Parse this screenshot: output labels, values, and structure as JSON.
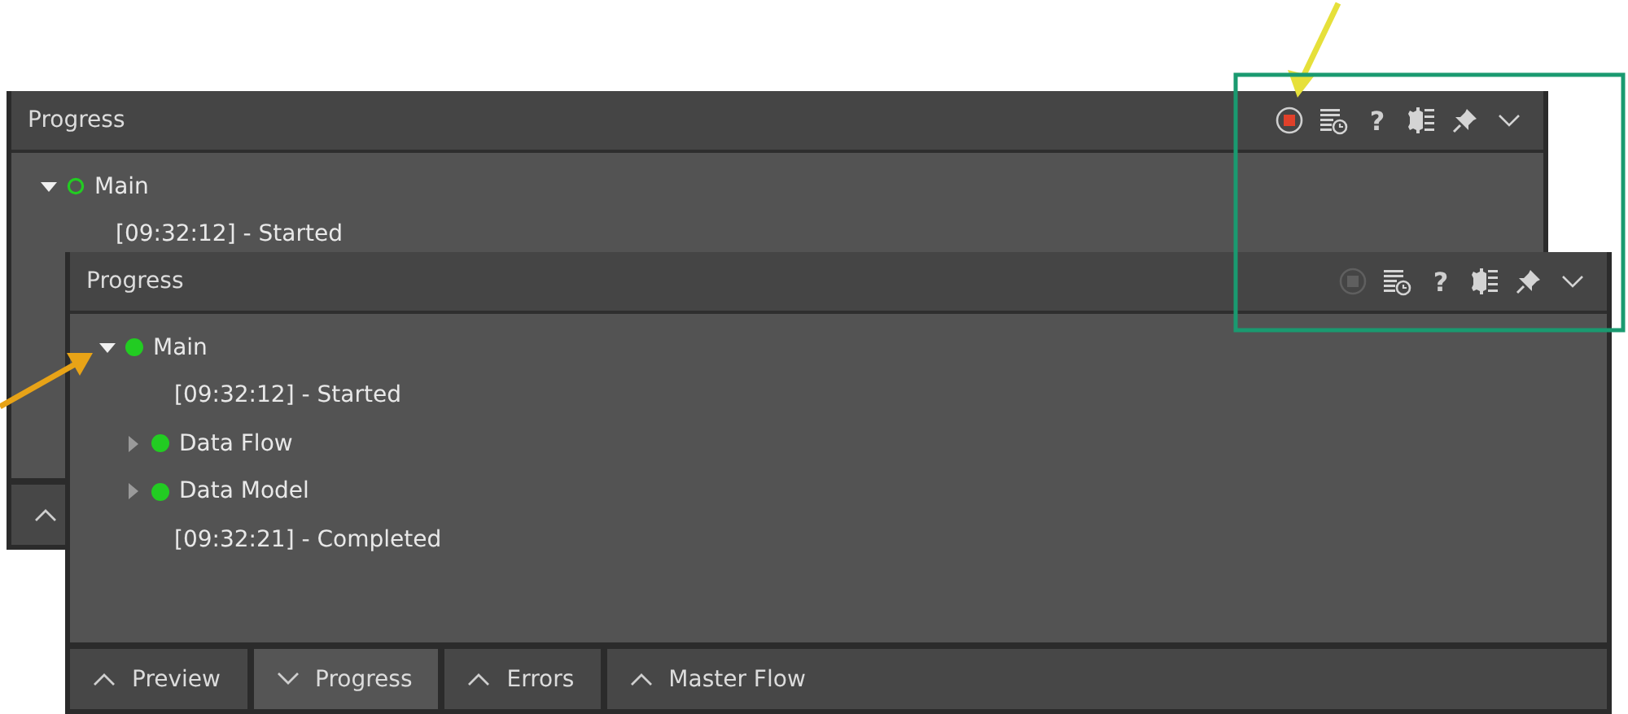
{
  "panels": [
    {
      "title": "Progress",
      "toolbar": {
        "stop_enabled": true,
        "help": "?"
      },
      "tree": [
        {
          "kind": "node",
          "label": "Main",
          "expanded": true,
          "in_progress": true,
          "color": "#22cc22",
          "children": [
            {
              "kind": "log",
              "label": "[09:32:12] - Started"
            }
          ]
        }
      ],
      "tabs": [
        {
          "selected": false
        }
      ]
    },
    {
      "title": "Progress",
      "toolbar": {
        "stop_enabled": false,
        "help": "?"
      },
      "tree": [
        {
          "kind": "node",
          "label": "Main",
          "expanded": true,
          "in_progress": false,
          "color": "#22cc22",
          "children": [
            {
              "kind": "log",
              "label": "[09:32:12] - Started"
            },
            {
              "kind": "node",
              "label": "Data Flow",
              "expanded": false,
              "in_progress": false,
              "color": "#22cc22"
            },
            {
              "kind": "node",
              "label": "Data Model",
              "expanded": false,
              "in_progress": false,
              "color": "#22cc22"
            },
            {
              "kind": "log",
              "label": "[09:32:21] - Completed"
            }
          ]
        }
      ],
      "tabs": [
        {
          "label": "Preview",
          "selected": false
        },
        {
          "label": "Progress",
          "selected": true
        },
        {
          "label": "Errors",
          "selected": false
        },
        {
          "label": "Master Flow",
          "selected": false
        }
      ]
    }
  ],
  "annotations": [
    {
      "kind": "arrow",
      "color": "#e6e03a"
    },
    {
      "kind": "arrow",
      "color": "#e8a317"
    },
    {
      "kind": "frame",
      "color": "#1a9a70"
    }
  ]
}
